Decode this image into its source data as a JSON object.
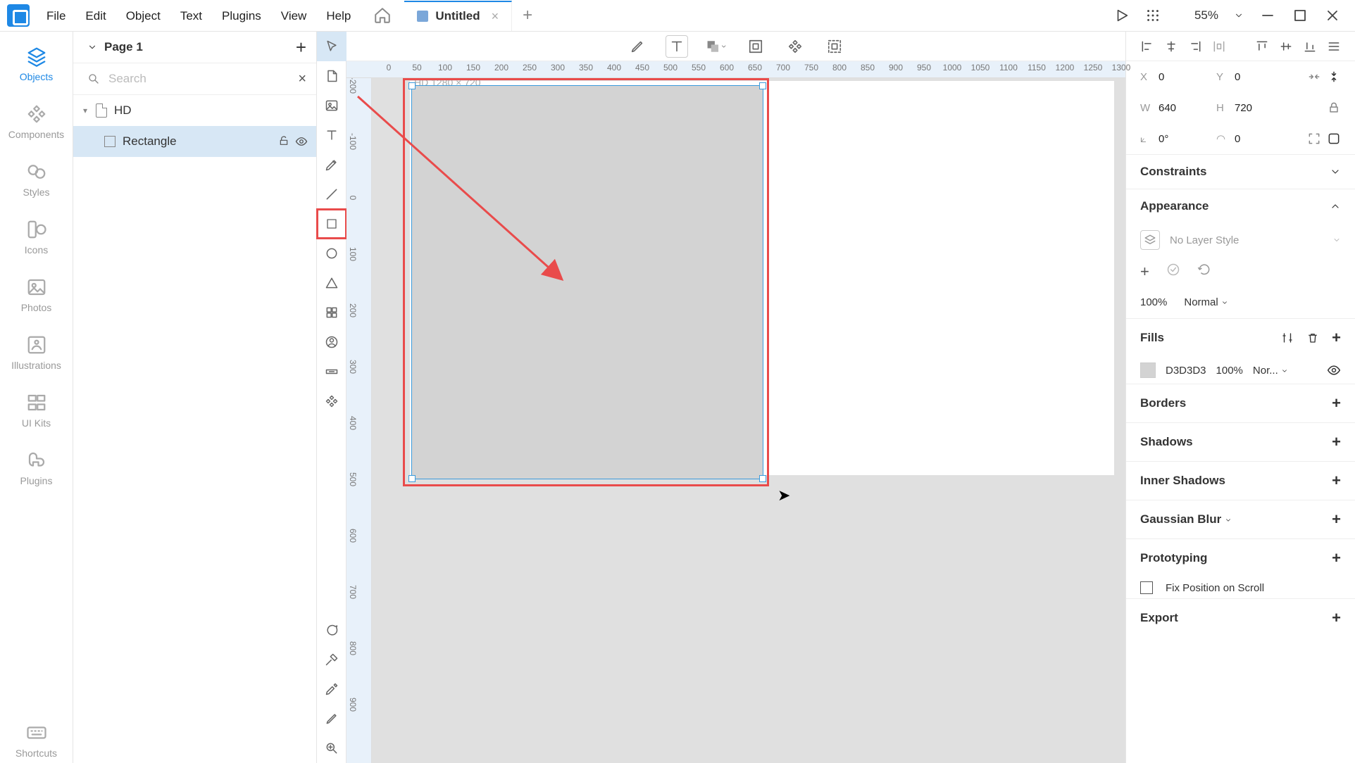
{
  "menubar": {
    "items": [
      "File",
      "Edit",
      "Object",
      "Text",
      "Plugins",
      "View",
      "Help"
    ]
  },
  "tab": {
    "title": "Untitled"
  },
  "zoom": {
    "label": "55%"
  },
  "left_rail": {
    "items": [
      {
        "label": "Objects",
        "active": true
      },
      {
        "label": "Components",
        "active": false
      },
      {
        "label": "Styles",
        "active": false
      },
      {
        "label": "Icons",
        "active": false
      },
      {
        "label": "Photos",
        "active": false
      },
      {
        "label": "Illustrations",
        "active": false
      },
      {
        "label": "UI Kits",
        "active": false
      },
      {
        "label": "Plugins",
        "active": false
      }
    ],
    "bottom": {
      "label": "Shortcuts"
    }
  },
  "objects_panel": {
    "page_name": "Page 1",
    "search_placeholder": "Search",
    "layers": [
      {
        "name": "HD",
        "kind": "frame"
      },
      {
        "name": "Rectangle",
        "kind": "rect",
        "selected": true
      }
    ]
  },
  "canvas": {
    "artboard_label": "HD 1280 × 720",
    "ruler_h_ticks": [
      "0",
      "50",
      "100",
      "150",
      "200",
      "250",
      "300",
      "350",
      "400",
      "450",
      "500",
      "550",
      "600",
      "650",
      "700",
      "750",
      "800",
      "850",
      "900",
      "950",
      "1000",
      "1050",
      "1100",
      "1150",
      "1200",
      "1250",
      "1300"
    ],
    "ruler_v_ticks": [
      "-200",
      "-100",
      "0",
      "100",
      "200",
      "300",
      "400",
      "500",
      "600",
      "700",
      "800",
      "900"
    ]
  },
  "properties": {
    "x": "0",
    "y": "0",
    "w": "640",
    "h": "720",
    "rotation": "0°",
    "corner": "0",
    "constraints_label": "Constraints",
    "appearance_label": "Appearance",
    "layer_style_text": "No Layer Style",
    "opacity": "100%",
    "blend": "Normal",
    "fills_label": "Fills",
    "fill_color": "D3D3D3",
    "fill_opacity": "100%",
    "fill_blend": "Nor...",
    "borders_label": "Borders",
    "shadows_label": "Shadows",
    "inner_shadows_label": "Inner Shadows",
    "gaussian_blur_label": "Gaussian Blur",
    "prototyping_label": "Prototyping",
    "fix_scroll_label": "Fix Position on Scroll",
    "export_label": "Export"
  }
}
